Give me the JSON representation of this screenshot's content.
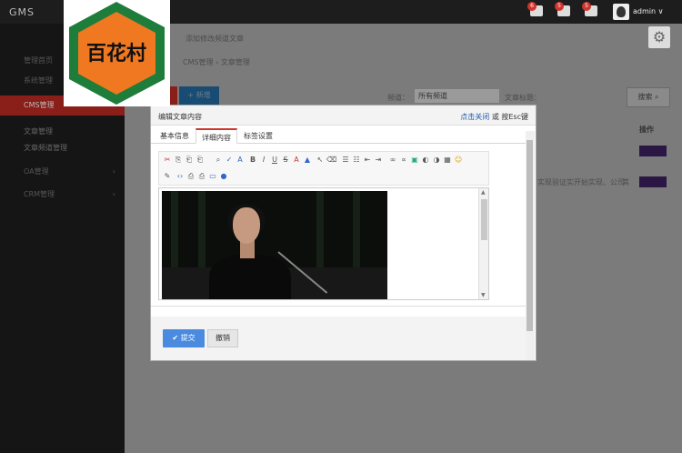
{
  "brand": {
    "text_a": "GMS",
    "text_b": ""
  },
  "topbar": {
    "notifications": [
      {
        "count": "6",
        "icon": "bell-icon"
      },
      {
        "count": "5",
        "icon": "mail-icon"
      },
      {
        "count": "5",
        "icon": "chat-icon"
      }
    ],
    "user": "admin",
    "caret": "∨"
  },
  "logo": {
    "text": "百花村",
    "hex_color": "#1e7d3a",
    "inner_color": "#f07820"
  },
  "sidebar": {
    "items": [
      {
        "label": "管理首页",
        "arrow": ""
      },
      {
        "label": "系统管理",
        "arrow": "›"
      },
      {
        "label": "CMS管理",
        "arrow": "›"
      },
      {
        "label": "OA管理",
        "arrow": "›"
      },
      {
        "label": "CRM管理",
        "arrow": "›"
      }
    ],
    "subitems": [
      "文章管理",
      "文章频道管理"
    ]
  },
  "page": {
    "breadcrumb_top": "添加修改频道文章",
    "breadcrumb": "CMS管理 › 文章管理",
    "add_button": "+ 新增",
    "channel_label": "频道：",
    "channel_value": "所有频道",
    "title_label": "文章标题：",
    "search_button": "搜索",
    "column_op": "操作",
    "row_text": "实现验证实开始实现、公司",
    "row_end": "其"
  },
  "modal": {
    "title": "编辑文章内容",
    "close_hint_link": "点击关闭",
    "close_hint_rest": "或 按Esc键",
    "tabs": [
      "基本信息",
      "详细内容",
      "标签设置"
    ],
    "active_tab": 1,
    "submit": "提交",
    "cancel": "撤销",
    "submit_icon": "✔"
  },
  "colors": {
    "accent": "#d0342c",
    "primary": "#4a8be0",
    "sidebar_active": "#8a1e19"
  }
}
